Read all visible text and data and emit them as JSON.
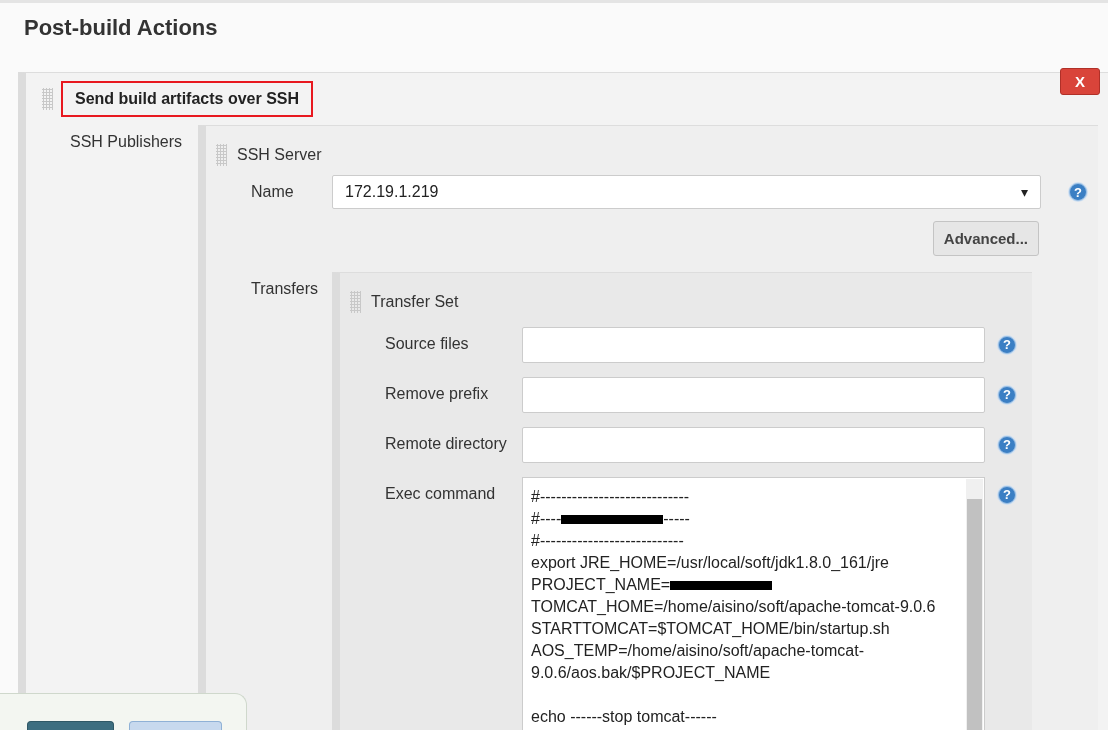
{
  "section_title": "Post-build Actions",
  "step": {
    "title": "Send build artifacts over SSH",
    "highlighted": true,
    "delete_button": "X",
    "label": "SSH Publishers",
    "server": {
      "title": "SSH Server",
      "name_label": "Name",
      "name_value": "172.19.1.219",
      "dropdown_arrow": "▾",
      "help": "?",
      "advanced_button": "Advanced...",
      "transfers_label": "Transfers",
      "transfer_set": {
        "title": "Transfer Set",
        "fields": [
          {
            "kind": "input",
            "label": "Source files",
            "help": "?"
          },
          {
            "kind": "input",
            "label": "Remove prefix",
            "help": "?"
          },
          {
            "kind": "input",
            "label": "Remote directory",
            "help": "?"
          },
          {
            "kind": "textarea",
            "label": "Exec command",
            "help": "?",
            "lines": [
              [
                {
                  "kind": "text",
                  "text": "#----------------------------"
                }
              ],
              [
                {
                  "kind": "text",
                  "text": "#----"
                },
                {
                  "kind": "redaction"
                },
                {
                  "kind": "text",
                  "text": "-----"
                }
              ],
              [
                {
                  "kind": "text",
                  "text": "#---------------------------"
                }
              ],
              [
                {
                  "kind": "text",
                  "text": "export JRE_HOME=/usr/local/soft/jdk1.8.0_161/jre"
                }
              ],
              [
                {
                  "kind": "text",
                  "text": "PROJECT_NAME="
                },
                {
                  "kind": "redaction"
                }
              ],
              [
                {
                  "kind": "text",
                  "text": "TOMCAT_HOME=/home/aisino/soft/apache-tomcat-9.0.6"
                }
              ],
              [
                {
                  "kind": "text",
                  "text": "STARTTOMCAT=$TOMCAT_HOME/bin/startup.sh"
                }
              ],
              [
                {
                  "kind": "text",
                  "text": "AOS_TEMP=/home/aisino/soft/apache-tomcat-"
                }
              ],
              [
                {
                  "kind": "text",
                  "text": "9.0.6/aos.bak/$PROJECT_NAME"
                }
              ],
              [
                {
                  "kind": "blank"
                }
              ],
              [
                {
                  "kind": "text",
                  "text": "echo ------stop tomcat------"
                }
              ]
            ]
          }
        ]
      }
    }
  },
  "bottom_bar": {
    "buttons": [
      {
        "kind": "primary"
      },
      {
        "kind": "secondary"
      }
    ]
  }
}
